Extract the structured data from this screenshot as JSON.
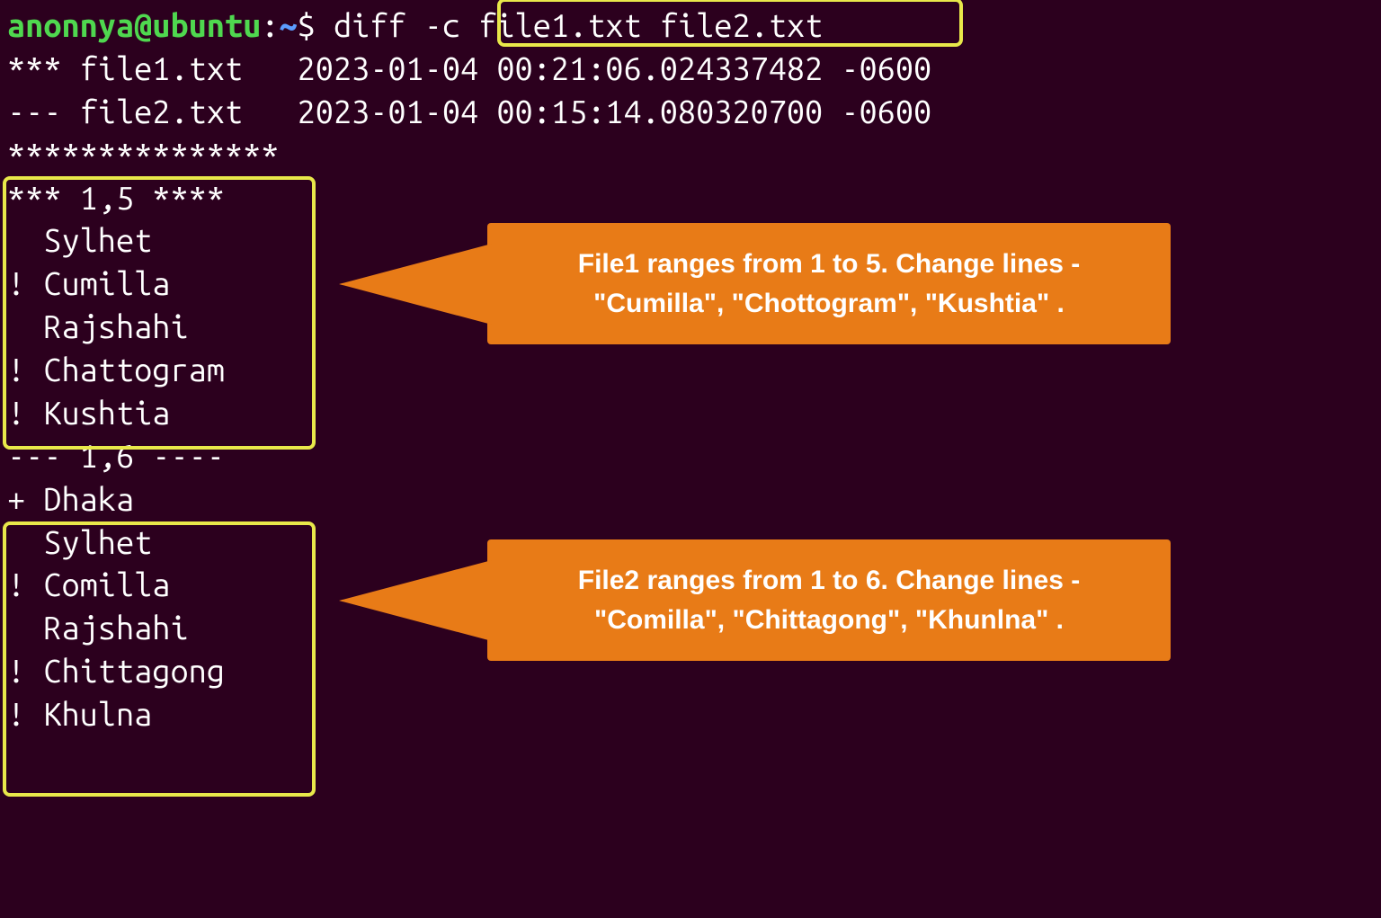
{
  "prompt": {
    "user": "anonnya",
    "at": "@",
    "host": "ubuntu",
    "colon": ":",
    "path": "~",
    "dollar": "$",
    "cmd_prefix": " diff ",
    "cmd_args": "-c file1.txt file2.txt"
  },
  "output": {
    "header1": "*** file1.txt   2023-01-04 00:21:06.024337482 -0600",
    "header2": "--- file2.txt   2023-01-04 00:15:14.080320700 -0600",
    "sep": "***************",
    "range1": "*** 1,5 ****",
    "file1_lines": [
      "  Sylhet",
      "! Cumilla",
      "  Rajshahi",
      "! Chattogram",
      "! Kushtia"
    ],
    "range2": "--- 1,6 ----",
    "file2_lines": [
      "+ Dhaka",
      "  Sylhet",
      "! Comilla",
      "  Rajshahi",
      "! Chittagong",
      "! Khulna"
    ]
  },
  "callouts": {
    "c1_line1": "File1 ranges from 1 to 5. Change lines -",
    "c1_line2": "\"Cumilla\", \"Chottogram\", \"Kushtia\" .",
    "c2_line1": "File2 ranges from 1 to 6. Change lines -",
    "c2_line2": "\"Comilla\", \"Chittagong\", \"Khunlna\" ."
  }
}
